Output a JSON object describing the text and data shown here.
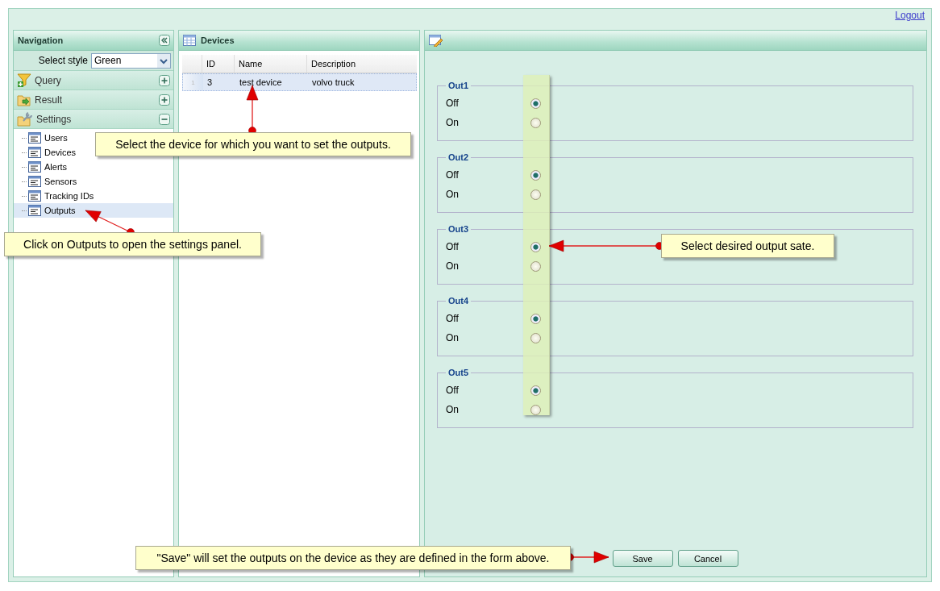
{
  "header": {
    "logout": "Logout"
  },
  "navigation": {
    "title": "Navigation",
    "select_style": {
      "label": "Select style",
      "value": "Green"
    },
    "sections": [
      {
        "kind": "query",
        "label": "Query",
        "expanded": false
      },
      {
        "kind": "result",
        "label": "Result",
        "expanded": false
      },
      {
        "kind": "settings",
        "label": "Settings",
        "expanded": true,
        "children": [
          {
            "label": "Users",
            "selected": false
          },
          {
            "label": "Devices",
            "selected": false
          },
          {
            "label": "Alerts",
            "selected": false
          },
          {
            "label": "Sensors",
            "selected": false
          },
          {
            "label": "Tracking IDs",
            "selected": false
          },
          {
            "label": "Outputs",
            "selected": true
          }
        ]
      }
    ]
  },
  "devices": {
    "title": "Devices",
    "columns": [
      "ID",
      "Name",
      "Description"
    ],
    "rows": [
      {
        "row_number": "1",
        "cells": [
          "3",
          "test device",
          "volvo truck"
        ],
        "selected": true
      }
    ]
  },
  "form": {
    "fieldsets": [
      {
        "legend": "Out1",
        "options": [
          {
            "label": "Off",
            "selected": true
          },
          {
            "label": "On",
            "selected": false
          }
        ]
      },
      {
        "legend": "Out2",
        "options": [
          {
            "label": "Off",
            "selected": true
          },
          {
            "label": "On",
            "selected": false
          }
        ]
      },
      {
        "legend": "Out3",
        "options": [
          {
            "label": "Off",
            "selected": true
          },
          {
            "label": "On",
            "selected": false
          }
        ]
      },
      {
        "legend": "Out4",
        "options": [
          {
            "label": "Off",
            "selected": true
          },
          {
            "label": "On",
            "selected": false
          }
        ]
      },
      {
        "legend": "Out5",
        "options": [
          {
            "label": "Off",
            "selected": true
          },
          {
            "label": "On",
            "selected": false
          }
        ]
      }
    ],
    "buttons": [
      "Save",
      "Cancel"
    ]
  },
  "callouts": [
    {
      "text": "Select the device for which you want to set the outputs."
    },
    {
      "text": "Click on Outputs to open the settings panel."
    },
    {
      "text": "Select desired output sate."
    },
    {
      "text": "\"Save\" will set the outputs on the device as they are defined in the form above."
    }
  ]
}
